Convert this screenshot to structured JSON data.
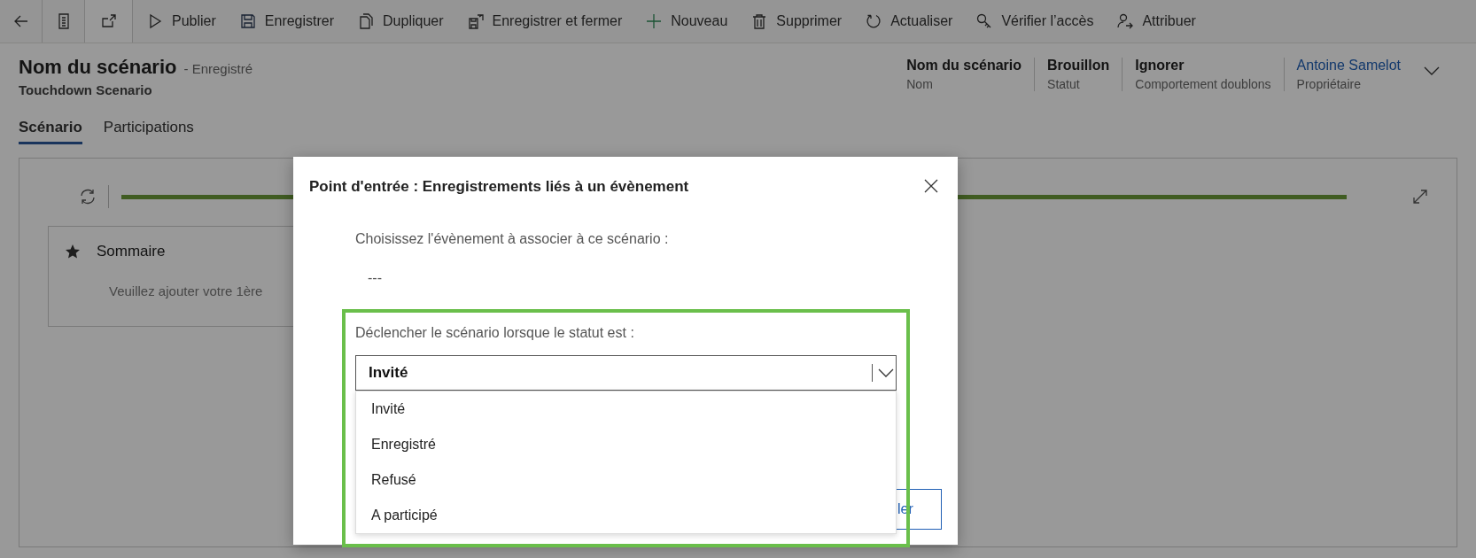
{
  "toolbar": {
    "actions": [
      {
        "label": "Publier"
      },
      {
        "label": "Enregistrer"
      },
      {
        "label": "Dupliquer"
      },
      {
        "label": "Enregistrer et fermer"
      },
      {
        "label": "Nouveau"
      },
      {
        "label": "Supprimer"
      },
      {
        "label": "Actualiser"
      },
      {
        "label": "Vérifier l’accès"
      },
      {
        "label": "Attribuer"
      }
    ]
  },
  "header": {
    "title": "Nom du scénario",
    "save_state": "- Enregistré",
    "subtitle": "Touchdown Scenario",
    "fields": [
      {
        "value": "Nom du scénario",
        "label": "Nom",
        "kind": "text"
      },
      {
        "value": "Brouillon",
        "label": "Statut",
        "kind": "text"
      },
      {
        "value": "Ignorer",
        "label": "Comportement doublons",
        "kind": "text"
      },
      {
        "value": "Antoine Samelot",
        "label": "Propriétaire",
        "kind": "link"
      }
    ]
  },
  "tabs": [
    {
      "label": "Scénario",
      "selected": true
    },
    {
      "label": "Participations",
      "selected": false
    }
  ],
  "designer": {
    "tile": {
      "title": "Sommaire",
      "hint": "Veuillez ajouter votre 1ère"
    }
  },
  "dialog": {
    "title": "Point d'entrée : Enregistrements liés à un évènement",
    "prompt": "Choisissez l'évènement à associer à ce scénario :",
    "event_value": "---",
    "trigger_label": "Déclencher le scénario lorsque le statut est :",
    "dropdown": {
      "value": "Invité",
      "expanded": true,
      "options": [
        {
          "label": "Invité"
        },
        {
          "label": "Enregistré"
        },
        {
          "label": "Refusé"
        },
        {
          "label": "A participé"
        }
      ]
    },
    "footer_button": "ler"
  }
}
